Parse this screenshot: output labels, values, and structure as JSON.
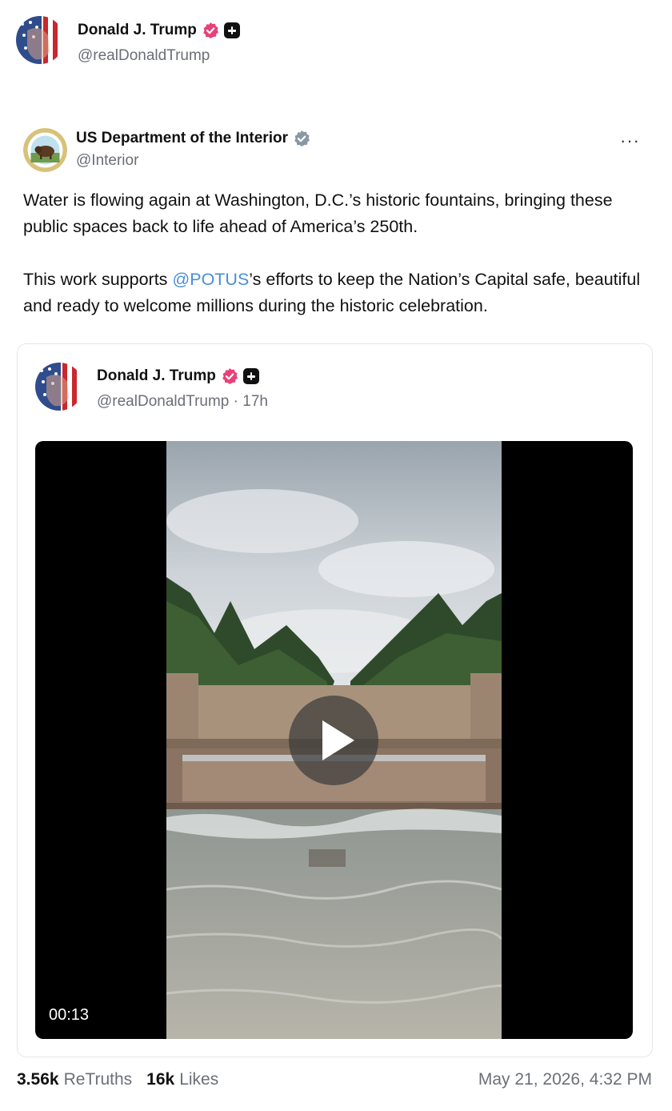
{
  "reposter": {
    "name": "Donald J. Trump",
    "handle": "@realDonaldTrump"
  },
  "post": {
    "author_name": "US Department of the Interior",
    "author_handle": "@Interior",
    "more_label": "···",
    "text_line1": "Water is flowing again at Washington, D.C.’s historic fountains, bringing these public spaces back to life ahead of America’s 250th.",
    "text_p2_before": "This work supports ",
    "text_p2_mention": "@POTUS",
    "text_p2_after": "’s efforts to keep the Nation’s Capital safe, beautiful and ready to welcome millions during the historic celebration."
  },
  "quoted": {
    "name": "Donald J. Trump",
    "handle": "@realDonaldTrump",
    "time": "17h",
    "separator": "·",
    "video_duration": "00:13"
  },
  "stats": {
    "retruths_count": "3.56k",
    "retruths_label": "ReTruths",
    "likes_count": "16k",
    "likes_label": "Likes",
    "timestamp": "May 21, 2026, 4:32 PM"
  },
  "colors": {
    "verified_badge": "#e8417a",
    "interior_badge": "#8a97a6",
    "mention": "#4a8fd6"
  }
}
